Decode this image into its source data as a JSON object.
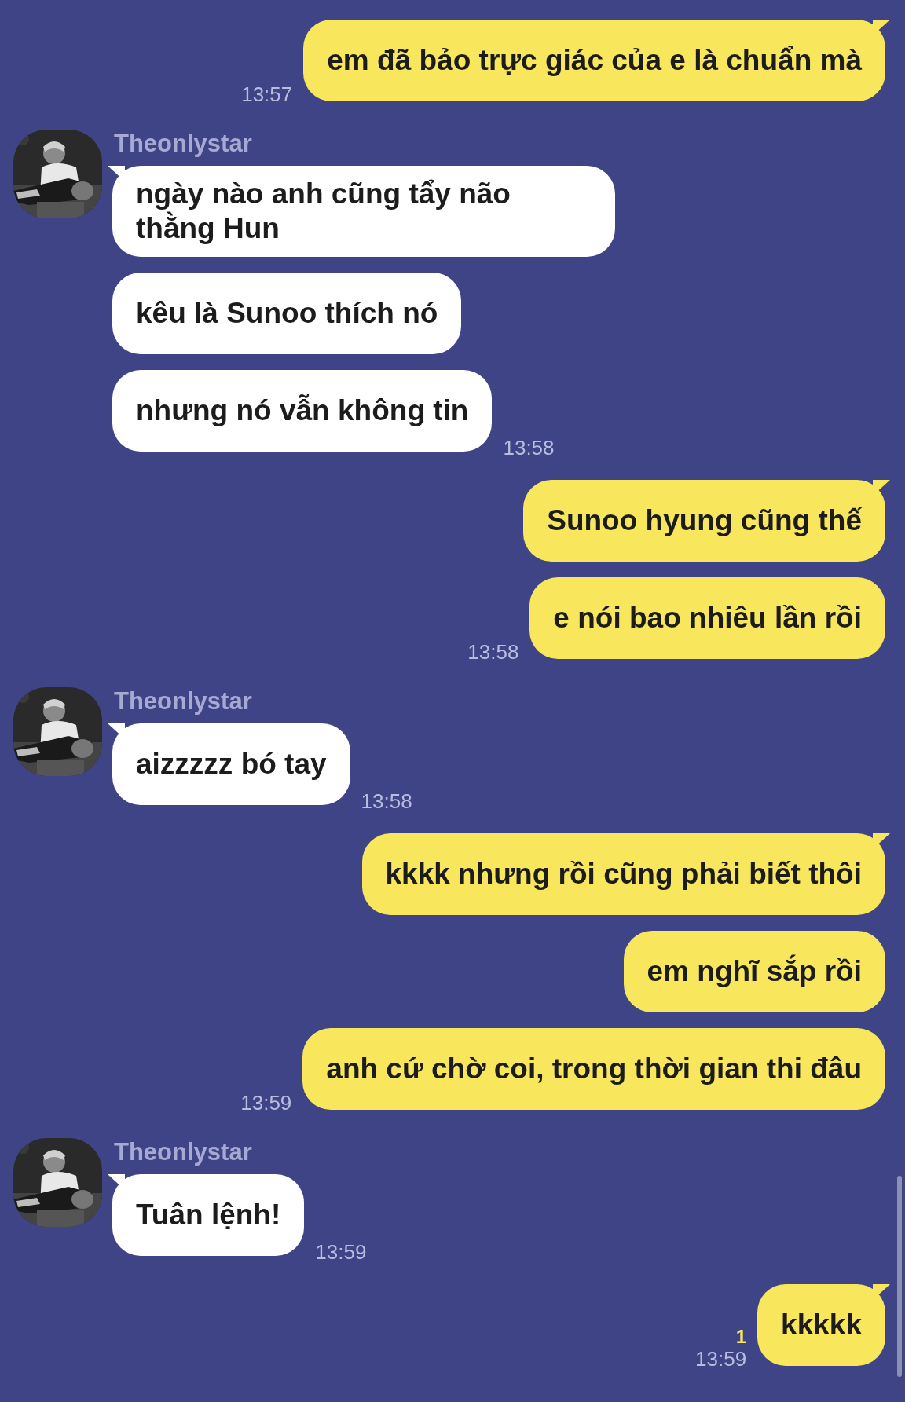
{
  "messages": [
    {
      "kind": "sent",
      "bubbles": [
        "em đã bảo trực giác của e là chuẩn mà"
      ],
      "time": "13:57"
    },
    {
      "kind": "received",
      "sender": "Theonlystar",
      "bubbles": [
        "ngày nào anh cũng tẩy não thằng Hun",
        "kêu là Sunoo thích nó",
        "nhưng nó vẫn không tin"
      ],
      "time": "13:58"
    },
    {
      "kind": "sent",
      "bubbles": [
        "Sunoo hyung cũng thế",
        "e nói bao nhiêu lần rồi"
      ],
      "time": "13:58"
    },
    {
      "kind": "received",
      "sender": "Theonlystar",
      "bubbles": [
        "aizzzzz bó tay"
      ],
      "time": "13:58"
    },
    {
      "kind": "sent",
      "bubbles": [
        "kkkk nhưng rồi cũng phải biết thôi",
        "em nghĩ sắp rồi",
        "anh cứ chờ coi, trong thời gian thi đâu"
      ],
      "time": "13:59"
    },
    {
      "kind": "received",
      "sender": "Theonlystar",
      "bubbles": [
        "Tuân lệnh!"
      ],
      "time": "13:59"
    },
    {
      "kind": "sent",
      "bubbles": [
        "kkkkk"
      ],
      "time": "13:59",
      "unread": "1"
    }
  ]
}
